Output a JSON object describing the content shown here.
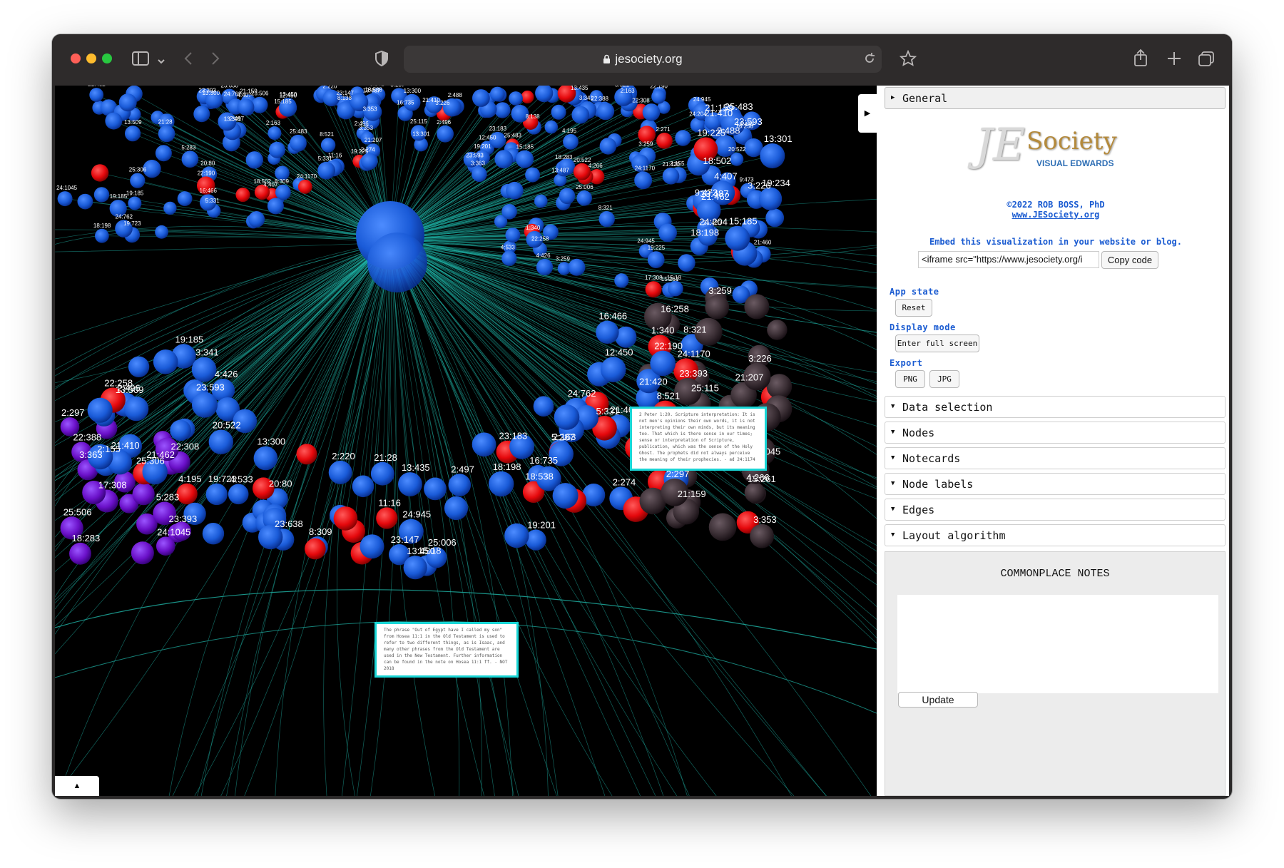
{
  "browser": {
    "url": "jesociety.org",
    "icons": [
      "sidebar-icon",
      "chevron-down-icon",
      "back-icon",
      "forward-icon",
      "shield-icon",
      "lock-icon",
      "reload-icon",
      "star-icon",
      "share-icon",
      "plus-icon",
      "tabs-icon"
    ]
  },
  "viz": {
    "hub_color": "#1860d8",
    "edge_color": "#1fb5a8",
    "node_colors": {
      "blue": "#1a5bd8",
      "red": "#e5080c",
      "purple": "#6a10c8",
      "gray": "#3a2e34"
    },
    "labels": [
      "21:420",
      "13:300",
      "13:487",
      "2:496",
      "3:259",
      "13:435",
      "3:353",
      "19:225",
      "25:483",
      "4:407",
      "20:522",
      "19:185",
      "2:163",
      "21:410",
      "24:762",
      "5:331",
      "24:945",
      "3:341",
      "15:185",
      "13:301",
      "24:1170",
      "22:258",
      "18:198",
      "21:462",
      "12:450",
      "22:190",
      "23:593",
      "8:521",
      "21:207",
      "21:159",
      "8:138",
      "23:393",
      "3:226",
      "2:297",
      "24:1045",
      "24:204",
      "18:502",
      "15:261",
      "25:306",
      "22:388",
      "4:533",
      "4:266",
      "16:735",
      "9:473",
      "15:18",
      "19:201",
      "3:363",
      "25:006",
      "4:195",
      "23:147",
      "8:309",
      "20:80",
      "16:258",
      "19:723",
      "11:16",
      "18:538",
      "22:308",
      "2:488",
      "23:638",
      "13:509",
      "18:283",
      "25:115",
      "5:287",
      "8:321",
      "2:155",
      "2:497",
      "2:271",
      "23:183",
      "17:308",
      "19:234",
      "25:506",
      "4:426",
      "16:466",
      "21:460",
      "1:340",
      "2:274",
      "21:28",
      "5:283",
      "2:220",
      "13:450"
    ]
  },
  "notecards": [
    {
      "text": "The phrase \"Out of Egypt have I called my son\" from Hosea 11:1 in the Old Testament is used to refer to two different things, as is Isaac, and many other phrases from the Old Testament are used in the New Testament. Further information can be found in the note on Hosea 11:1 ff. - NOT 2018"
    },
    {
      "text": "2 Peter 1:20. Scripture interpretation: It is not men's opinions their own words, it is not interpreting their own minds, but its meaning too. That which is there sense in our times; sense or interpretation of Scripture, publication, which was the sense of the Holy Ghost. The prophets did not always perceive the meaning of their prophecies. - ad 24:1174"
    }
  ],
  "panel": {
    "general_label": "General",
    "logo_letters": "JE",
    "logo_word": "Society",
    "logo_sub": "VISUAL EDWARDS",
    "copyright": "©2022 ROB BOSS, PhD",
    "site_link": "www.JESociety.org",
    "embed_text": "Embed this visualization in your website or blog.",
    "embed_code": "<iframe src=\"https://www.jesociety.org/i",
    "copy_code": "Copy code",
    "app_state": "App state",
    "reset": "Reset",
    "display_mode": "Display mode",
    "full_screen": "Enter full screen",
    "export": "Export",
    "png": "PNG",
    "jpg": "JPG",
    "folders": [
      "Data selection",
      "Nodes",
      "Notecards",
      "Node labels",
      "Edges",
      "Layout algorithm"
    ],
    "notes_title": "COMMONPLACE NOTES",
    "notes_value": "",
    "update": "Update"
  }
}
